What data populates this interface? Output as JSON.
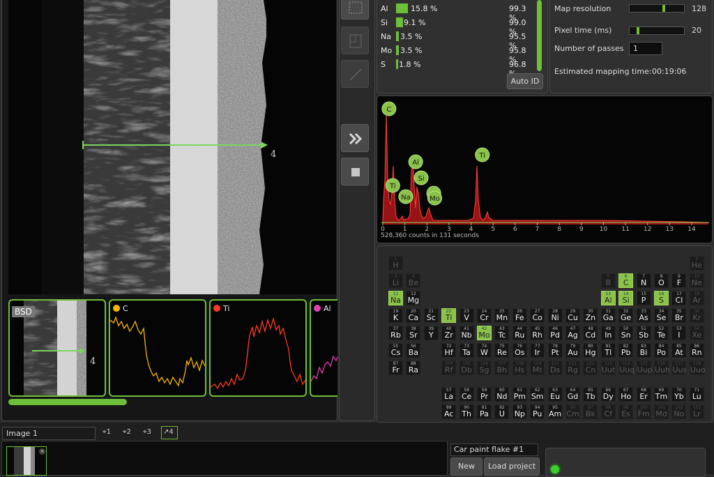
{
  "elements_list": [
    {
      "symbol": "Al",
      "weight": "15.8 %",
      "confidence": "99.3 %",
      "fraction": 0.158
    },
    {
      "symbol": "Si",
      "weight": "9.1 %",
      "confidence": "99.0 %",
      "fraction": 0.091
    },
    {
      "symbol": "Na",
      "weight": "3.5 %",
      "confidence": "95.5 %",
      "fraction": 0.035
    },
    {
      "symbol": "Mo",
      "weight": "3.5 %",
      "confidence": "95.8 %",
      "fraction": 0.035
    },
    {
      "symbol": "S",
      "weight": "1.8 %",
      "confidence": "96.8 %",
      "fraction": 0.018
    }
  ],
  "auto_id_label": "Auto ID",
  "settings": {
    "map_resolution_label": "Map resolution",
    "map_resolution_value": "128",
    "pixel_time_label": "Pixel time (ms)",
    "pixel_time_value": "20",
    "passes_label": "Number of passes",
    "passes_value": "1",
    "est_time_label": "Estimated mapping time:",
    "est_time_value": "00:19:06"
  },
  "spectrum": {
    "counts_text": "528,360 counts in 131 seconds",
    "axis_ticks": [
      "0",
      "1",
      "2",
      "3",
      "4",
      "5",
      "6",
      "7",
      "8",
      "9",
      "10",
      "11",
      "12",
      "13",
      "14"
    ],
    "peak_labels": [
      {
        "label": "C",
        "energy": 0.28
      },
      {
        "label": "Al",
        "energy": 1.49
      },
      {
        "label": "Si",
        "energy": 1.74
      },
      {
        "label": "Ti",
        "energy": 4.51
      },
      {
        "label": "Ti",
        "energy": 0.45
      },
      {
        "label": "Na",
        "energy": 1.04
      },
      {
        "label": "S",
        "energy": 2.31
      },
      {
        "label": "Mo",
        "energy": 2.29
      }
    ]
  },
  "image_label": "Image 1",
  "line_label": "4",
  "bsd_label": "BSD",
  "linescans": [
    {
      "name": "C",
      "color": "#f5b800"
    },
    {
      "name": "Ti",
      "color": "#ff3b1f"
    },
    {
      "name": "Al",
      "color": "#e040b0"
    }
  ],
  "tools": [
    "1",
    "2",
    "3",
    "4"
  ],
  "project": {
    "name": "Car paint flake #1",
    "new_label": "New",
    "load_label": "Load project"
  },
  "highlight_color": "#8bc34a",
  "periodic_table": [
    [
      "1",
      "H",
      1,
      1,
      "dim"
    ],
    [
      "2",
      "He",
      18,
      1,
      "dim"
    ],
    [
      "3",
      "Li",
      1,
      2,
      "dim"
    ],
    [
      "4",
      "Be",
      2,
      2,
      "dim"
    ],
    [
      "5",
      "B",
      13,
      2,
      "dim"
    ],
    [
      "6",
      "C",
      14,
      2,
      "hi"
    ],
    [
      "7",
      "N",
      15,
      2,
      ""
    ],
    [
      "8",
      "O",
      16,
      2,
      ""
    ],
    [
      "9",
      "F",
      17,
      2,
      ""
    ],
    [
      "10",
      "Ne",
      18,
      2,
      "dim"
    ],
    [
      "11",
      "Na",
      1,
      3,
      "hi"
    ],
    [
      "12",
      "Mg",
      2,
      3,
      ""
    ],
    [
      "13",
      "Al",
      13,
      3,
      "hi"
    ],
    [
      "14",
      "Si",
      14,
      3,
      "hi"
    ],
    [
      "15",
      "P",
      15,
      3,
      ""
    ],
    [
      "16",
      "S",
      16,
      3,
      "hi"
    ],
    [
      "17",
      "Cl",
      17,
      3,
      ""
    ],
    [
      "18",
      "Ar",
      18,
      3,
      "dim"
    ],
    [
      "19",
      "K",
      1,
      4,
      ""
    ],
    [
      "20",
      "Ca",
      2,
      4,
      ""
    ],
    [
      "21",
      "Sc",
      3,
      4,
      ""
    ],
    [
      "22",
      "Ti",
      4,
      4,
      "hi"
    ],
    [
      "23",
      "V",
      5,
      4,
      ""
    ],
    [
      "24",
      "Cr",
      6,
      4,
      ""
    ],
    [
      "25",
      "Mn",
      7,
      4,
      ""
    ],
    [
      "26",
      "Fe",
      8,
      4,
      ""
    ],
    [
      "27",
      "Co",
      9,
      4,
      ""
    ],
    [
      "28",
      "Ni",
      10,
      4,
      ""
    ],
    [
      "29",
      "Cu",
      11,
      4,
      ""
    ],
    [
      "30",
      "Zn",
      12,
      4,
      ""
    ],
    [
      "31",
      "Ga",
      13,
      4,
      ""
    ],
    [
      "32",
      "Ge",
      14,
      4,
      ""
    ],
    [
      "33",
      "As",
      15,
      4,
      ""
    ],
    [
      "34",
      "Se",
      16,
      4,
      ""
    ],
    [
      "35",
      "Br",
      17,
      4,
      ""
    ],
    [
      "36",
      "Kr",
      18,
      4,
      "dim"
    ],
    [
      "37",
      "Rb",
      1,
      5,
      ""
    ],
    [
      "38",
      "Sr",
      2,
      5,
      ""
    ],
    [
      "39",
      "Y",
      3,
      5,
      ""
    ],
    [
      "40",
      "Zr",
      4,
      5,
      ""
    ],
    [
      "41",
      "Nb",
      5,
      5,
      ""
    ],
    [
      "42",
      "Mo",
      6,
      5,
      "hi"
    ],
    [
      "43",
      "Tc",
      7,
      5,
      ""
    ],
    [
      "44",
      "Ru",
      8,
      5,
      ""
    ],
    [
      "45",
      "Rh",
      9,
      5,
      ""
    ],
    [
      "46",
      "Pd",
      10,
      5,
      ""
    ],
    [
      "47",
      "Ag",
      11,
      5,
      ""
    ],
    [
      "48",
      "Cd",
      12,
      5,
      ""
    ],
    [
      "49",
      "In",
      13,
      5,
      ""
    ],
    [
      "50",
      "Sn",
      14,
      5,
      ""
    ],
    [
      "51",
      "Sb",
      15,
      5,
      ""
    ],
    [
      "52",
      "Te",
      16,
      5,
      ""
    ],
    [
      "53",
      "I",
      17,
      5,
      ""
    ],
    [
      "54",
      "Xe",
      18,
      5,
      "dim"
    ],
    [
      "55",
      "Cs",
      1,
      6,
      ""
    ],
    [
      "56",
      "Ba",
      2,
      6,
      ""
    ],
    [
      "72",
      "Hf",
      4,
      6,
      ""
    ],
    [
      "73",
      "Ta",
      5,
      6,
      ""
    ],
    [
      "74",
      "W",
      6,
      6,
      ""
    ],
    [
      "75",
      "Re",
      7,
      6,
      ""
    ],
    [
      "76",
      "Os",
      8,
      6,
      ""
    ],
    [
      "77",
      "Ir",
      9,
      6,
      ""
    ],
    [
      "78",
      "Pt",
      10,
      6,
      ""
    ],
    [
      "79",
      "Au",
      11,
      6,
      ""
    ],
    [
      "80",
      "Hg",
      12,
      6,
      ""
    ],
    [
      "81",
      "Tl",
      13,
      6,
      ""
    ],
    [
      "82",
      "Pb",
      14,
      6,
      ""
    ],
    [
      "83",
      "Bi",
      15,
      6,
      ""
    ],
    [
      "84",
      "Po",
      16,
      6,
      ""
    ],
    [
      "85",
      "At",
      17,
      6,
      ""
    ],
    [
      "86",
      "Rn",
      18,
      6,
      ""
    ],
    [
      "87",
      "Fr",
      1,
      7,
      ""
    ],
    [
      "88",
      "Ra",
      2,
      7,
      ""
    ],
    [
      "104",
      "Rf",
      4,
      7,
      "dim"
    ],
    [
      "105",
      "Db",
      5,
      7,
      "dim"
    ],
    [
      "106",
      "Sg",
      6,
      7,
      "dim"
    ],
    [
      "107",
      "Bh",
      7,
      7,
      "dim"
    ],
    [
      "108",
      "Hs",
      8,
      7,
      "dim"
    ],
    [
      "109",
      "Mt",
      9,
      7,
      "dim"
    ],
    [
      "110",
      "Ds",
      10,
      7,
      "dim"
    ],
    [
      "111",
      "Rg",
      11,
      7,
      "dim"
    ],
    [
      "112",
      "Cn",
      12,
      7,
      "dim"
    ],
    [
      "113",
      "Uut",
      13,
      7,
      "dim"
    ],
    [
      "114",
      "Uuq",
      14,
      7,
      "dim"
    ],
    [
      "115",
      "Uup",
      15,
      7,
      "dim"
    ],
    [
      "116",
      "Uuh",
      16,
      7,
      "dim"
    ],
    [
      "117",
      "Uus",
      17,
      7,
      "dim"
    ],
    [
      "118",
      "Uuo",
      18,
      7,
      "dim"
    ],
    [
      "57",
      "La",
      4,
      8.5,
      ""
    ],
    [
      "58",
      "Ce",
      5,
      8.5,
      ""
    ],
    [
      "59",
      "Pr",
      6,
      8.5,
      ""
    ],
    [
      "60",
      "Nd",
      7,
      8.5,
      ""
    ],
    [
      "61",
      "Pm",
      8,
      8.5,
      ""
    ],
    [
      "62",
      "Sm",
      9,
      8.5,
      ""
    ],
    [
      "63",
      "Eu",
      10,
      8.5,
      ""
    ],
    [
      "64",
      "Gd",
      11,
      8.5,
      ""
    ],
    [
      "65",
      "Tb",
      12,
      8.5,
      ""
    ],
    [
      "66",
      "Dy",
      13,
      8.5,
      ""
    ],
    [
      "67",
      "Ho",
      14,
      8.5,
      ""
    ],
    [
      "68",
      "Er",
      15,
      8.5,
      ""
    ],
    [
      "69",
      "Tm",
      16,
      8.5,
      ""
    ],
    [
      "70",
      "Yb",
      17,
      8.5,
      ""
    ],
    [
      "71",
      "Lu",
      18,
      8.5,
      ""
    ],
    [
      "89",
      "Ac",
      4,
      9.5,
      ""
    ],
    [
      "90",
      "Th",
      5,
      9.5,
      ""
    ],
    [
      "91",
      "Pa",
      6,
      9.5,
      ""
    ],
    [
      "92",
      "U",
      7,
      9.5,
      ""
    ],
    [
      "93",
      "Np",
      8,
      9.5,
      ""
    ],
    [
      "94",
      "Pu",
      9,
      9.5,
      ""
    ],
    [
      "95",
      "Am",
      10,
      9.5,
      ""
    ],
    [
      "96",
      "Cm",
      11,
      9.5,
      "dim"
    ],
    [
      "97",
      "Bk",
      12,
      9.5,
      "dim"
    ],
    [
      "98",
      "Cf",
      13,
      9.5,
      "dim"
    ],
    [
      "99",
      "Es",
      14,
      9.5,
      "dim"
    ],
    [
      "100",
      "Fm",
      15,
      9.5,
      "dim"
    ],
    [
      "101",
      "Md",
      16,
      9.5,
      "dim"
    ],
    [
      "102",
      "No",
      17,
      9.5,
      "dim"
    ],
    [
      "103",
      "Lr",
      18,
      9.5,
      "dim"
    ]
  ]
}
